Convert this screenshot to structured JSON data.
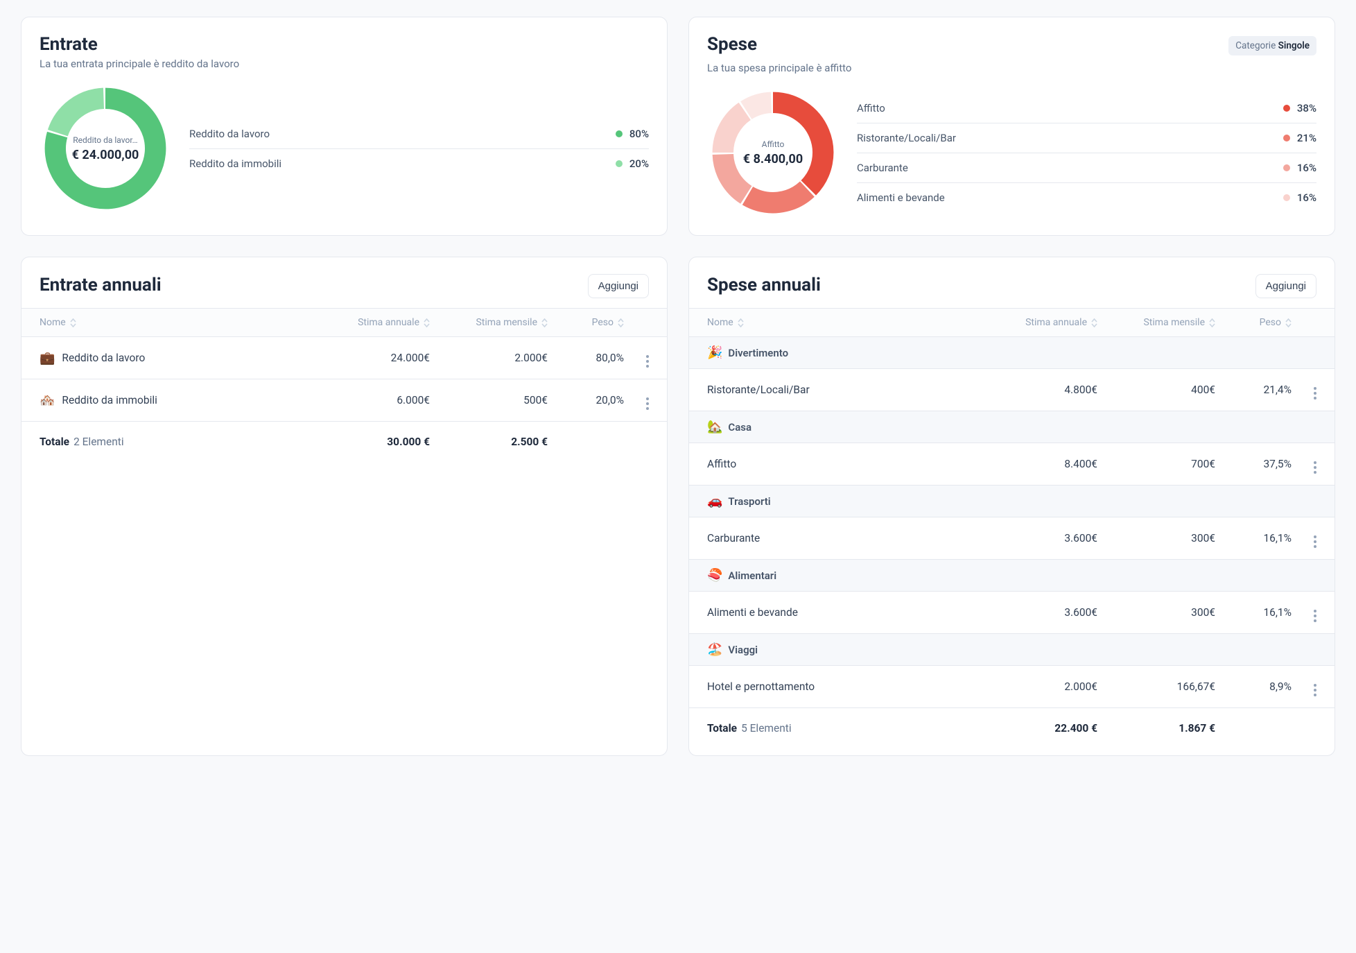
{
  "chart_data": [
    {
      "type": "pie",
      "title": "Entrate",
      "series": [
        {
          "name": "Reddito da lavoro",
          "value": 80,
          "color": "#55c57a"
        },
        {
          "name": "Reddito da immobili",
          "value": 20,
          "color": "#8fdfa7"
        }
      ],
      "center_label": "Reddito da lavor…",
      "center_value": "€ 24.000,00"
    },
    {
      "type": "pie",
      "title": "Spese",
      "series": [
        {
          "name": "Affitto",
          "value": 38,
          "color": "#e74c3c"
        },
        {
          "name": "Ristorante/Locali/Bar",
          "value": 21,
          "color": "#ef7c6f"
        },
        {
          "name": "Carburante",
          "value": 16,
          "color": "#f3a79e"
        },
        {
          "name": "Alimenti e bevande",
          "value": 16,
          "color": "#f9d2cd"
        }
      ],
      "center_label": "Affitto",
      "center_value": "€ 8.400,00"
    }
  ],
  "income_card": {
    "title": "Entrate",
    "subtitle": "La tua entrata principale è reddito da lavoro",
    "center_label": "Reddito da lavor…",
    "center_value": "€ 24.000,00",
    "legend": [
      {
        "name": "Reddito da lavoro",
        "pct": "80%",
        "color": "#55c57a"
      },
      {
        "name": "Reddito da immobili",
        "pct": "20%",
        "color": "#8fdfa7"
      }
    ]
  },
  "expense_card": {
    "title": "Spese",
    "subtitle": "La tua spesa principale è affitto",
    "badge_prefix": "Categorie ",
    "badge_value": "Singole",
    "center_label": "Affitto",
    "center_value": "€ 8.400,00",
    "legend": [
      {
        "name": "Affitto",
        "pct": "38%",
        "color": "#e74c3c"
      },
      {
        "name": "Ristorante/Locali/Bar",
        "pct": "21%",
        "color": "#ef7c6f"
      },
      {
        "name": "Carburante",
        "pct": "16%",
        "color": "#f3a79e"
      },
      {
        "name": "Alimenti e bevande",
        "pct": "16%",
        "color": "#f9d2cd"
      }
    ]
  },
  "income_table": {
    "title": "Entrate annuali",
    "add_label": "Aggiungi",
    "headers": {
      "name": "Nome",
      "annual": "Stima annuale",
      "monthly": "Stima mensile",
      "weight": "Peso"
    },
    "rows": [
      {
        "icon": "💼",
        "name": "Reddito da lavoro",
        "annual": "24.000€",
        "monthly": "2.000€",
        "weight": "80,0%"
      },
      {
        "icon": "🏘️",
        "name": "Reddito da immobili",
        "annual": "6.000€",
        "monthly": "500€",
        "weight": "20,0%"
      }
    ],
    "totals": {
      "label": "Totale",
      "count": "2 Elementi",
      "annual": "30.000 €",
      "monthly": "2.500 €"
    }
  },
  "expense_table": {
    "title": "Spese annuali",
    "add_label": "Aggiungi",
    "headers": {
      "name": "Nome",
      "annual": "Stima annuale",
      "monthly": "Stima mensile",
      "weight": "Peso"
    },
    "groups": [
      {
        "icon": "🎉",
        "name": "Divertimento",
        "rows": [
          {
            "name": "Ristorante/Locali/Bar",
            "annual": "4.800€",
            "monthly": "400€",
            "weight": "21,4%"
          }
        ]
      },
      {
        "icon": "🏡",
        "name": "Casa",
        "rows": [
          {
            "name": "Affitto",
            "annual": "8.400€",
            "monthly": "700€",
            "weight": "37,5%"
          }
        ]
      },
      {
        "icon": "🚗",
        "name": "Trasporti",
        "rows": [
          {
            "name": "Carburante",
            "annual": "3.600€",
            "monthly": "300€",
            "weight": "16,1%"
          }
        ]
      },
      {
        "icon": "🍣",
        "name": "Alimentari",
        "rows": [
          {
            "name": "Alimenti e bevande",
            "annual": "3.600€",
            "monthly": "300€",
            "weight": "16,1%"
          }
        ]
      },
      {
        "icon": "🏖️",
        "name": "Viaggi",
        "rows": [
          {
            "name": "Hotel e pernottamento",
            "annual": "2.000€",
            "monthly": "166,67€",
            "weight": "8,9%"
          }
        ]
      }
    ],
    "totals": {
      "label": "Totale",
      "count": "5 Elementi",
      "annual": "22.400 €",
      "monthly": "1.867 €"
    }
  }
}
